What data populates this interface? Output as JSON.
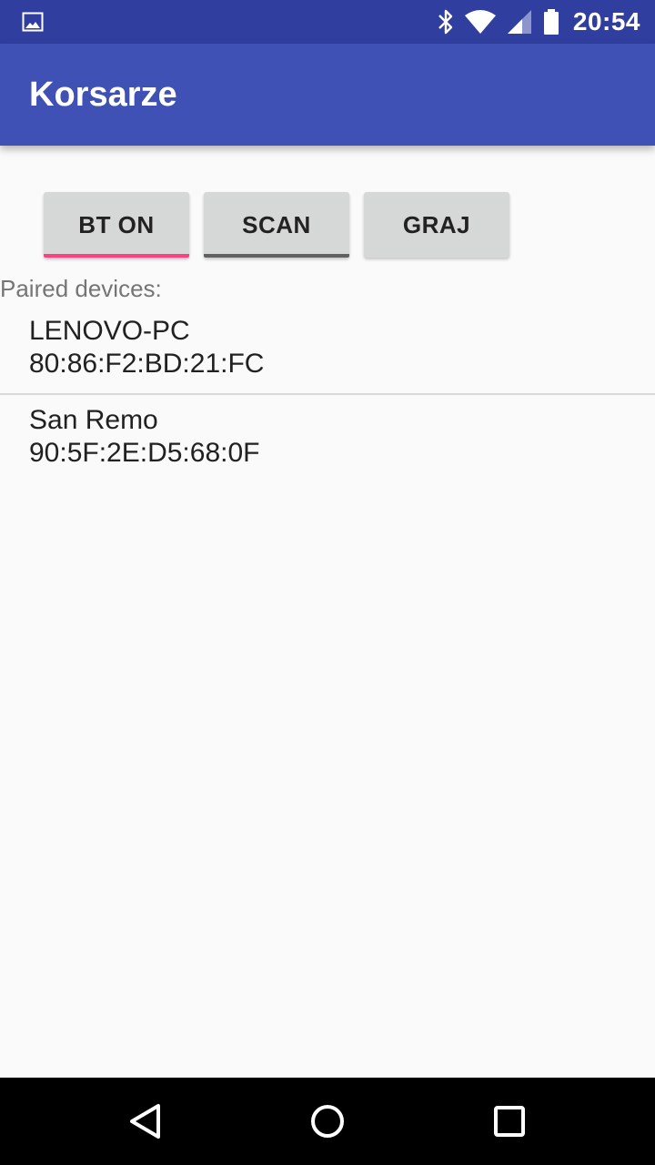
{
  "status_bar": {
    "time": "20:54",
    "icons": [
      "gallery-icon",
      "bluetooth-icon",
      "wifi-icon",
      "signal-icon",
      "battery-icon"
    ],
    "background": "#303f9f"
  },
  "app_bar": {
    "title": "Korsarze",
    "background": "#3f51b5"
  },
  "buttons": [
    {
      "label": "BT ON",
      "underline_color": "#ff4081"
    },
    {
      "label": "SCAN",
      "underline_color": "#616161"
    },
    {
      "label": "GRAJ",
      "underline_color": ""
    }
  ],
  "paired_label": "Paired devices:",
  "devices": [
    {
      "name": "LENOVO-PC",
      "mac": "80:86:F2:BD:21:FC"
    },
    {
      "name": "San Remo",
      "mac": "90:5F:2E:D5:68:0F"
    }
  ],
  "nav_bar": {
    "icons": [
      "back-icon",
      "home-icon",
      "recents-icon"
    ]
  }
}
